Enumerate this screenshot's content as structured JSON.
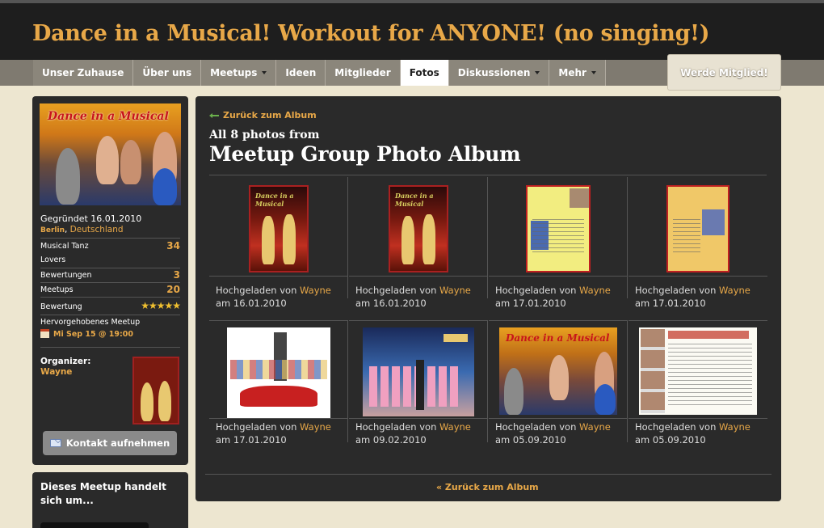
{
  "header": {
    "title": "Dance in a Musical! Workout for ANYONE! (no singing!)"
  },
  "nav": {
    "items": [
      {
        "label": "Unser Zuhause",
        "active": false,
        "dropdown": false
      },
      {
        "label": "Über uns",
        "active": false,
        "dropdown": false
      },
      {
        "label": "Meetups",
        "active": false,
        "dropdown": true
      },
      {
        "label": "Ideen",
        "active": false,
        "dropdown": false
      },
      {
        "label": "Mitglieder",
        "active": false,
        "dropdown": false
      },
      {
        "label": "Fotos",
        "active": true,
        "dropdown": false
      },
      {
        "label": "Diskussionen",
        "active": false,
        "dropdown": true
      },
      {
        "label": "Mehr",
        "active": false,
        "dropdown": true
      }
    ],
    "join_label": "Werde Mitglied!"
  },
  "sidebar": {
    "photo_title": "Dance in a Musical",
    "founded": "Gegründet 16.01.2010",
    "city": "Berlin",
    "country": "Deutschland",
    "stats": [
      {
        "label": "Musical Tanz",
        "label2": "Lovers",
        "value": "34"
      },
      {
        "label": "Bewertungen",
        "value": "3"
      },
      {
        "label": "Meetups",
        "value": "20"
      }
    ],
    "rating_label": "Bewertung",
    "rating_stars": 5,
    "rating_glyphs": "★★★★★",
    "featured_label": "Hervorgehobenes Meetup",
    "featured_date": "Mi Sep 15 @ 19:00",
    "organizer_label": "Organizer:",
    "organizer_name": "Wayne",
    "contact_label": "Kontakt aufnehmen"
  },
  "sidebar2": {
    "title": "Dieses Meetup handelt sich um..."
  },
  "main": {
    "back_top": "Zurück zum Album",
    "photo_count": "All 8 photos from",
    "album_title": "Meetup Group Photo Album",
    "back_bottom": "« Zurück zum Album",
    "uploaded_by": "Hochgeladen von",
    "photos": [
      {
        "uploader": "Wayne",
        "date": "am 16.01.2010",
        "kind": "poster-red"
      },
      {
        "uploader": "Wayne",
        "date": "am 16.01.2010",
        "kind": "poster-red"
      },
      {
        "uploader": "Wayne",
        "date": "am 17.01.2010",
        "kind": "poster-yellow"
      },
      {
        "uploader": "Wayne",
        "date": "am 17.01.2010",
        "kind": "poster-orange"
      },
      {
        "uploader": "Wayne",
        "date": "am 17.01.2010",
        "kind": "img-grease"
      },
      {
        "uploader": "Wayne",
        "date": "am 09.02.2010",
        "kind": "img-stage"
      },
      {
        "uploader": "Wayne",
        "date": "am 05.09.2010",
        "kind": "img-group"
      },
      {
        "uploader": "Wayne",
        "date": "am 05.09.2010",
        "kind": "img-flyer"
      }
    ]
  }
}
